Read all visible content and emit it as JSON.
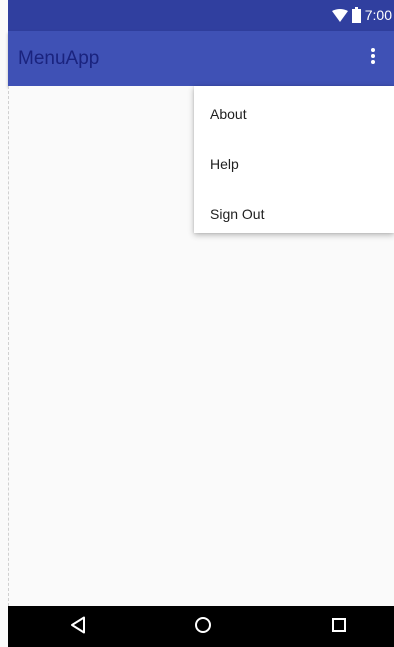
{
  "status_bar": {
    "time": "7:00",
    "icons": [
      "wifi-icon",
      "battery-icon"
    ]
  },
  "app_bar": {
    "title": "MenuApp",
    "overflow_icon": "more-vert-icon"
  },
  "overflow_menu": {
    "items": [
      {
        "label": "About"
      },
      {
        "label": "Help"
      },
      {
        "label": "Sign Out"
      }
    ]
  },
  "nav_bar": {
    "buttons": [
      "back-icon",
      "home-icon",
      "recents-icon"
    ]
  },
  "colors": {
    "primary": "#3f51b5",
    "primary_dark": "#303f9f",
    "title_text": "#1a237e",
    "background": "#fafafa",
    "nav_bar": "#000000"
  }
}
